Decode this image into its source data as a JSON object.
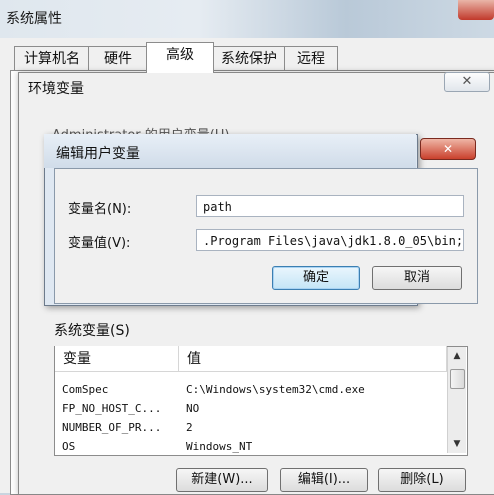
{
  "outer_window": {
    "title": "系统属性"
  },
  "tabs": [
    {
      "label": "计算机名"
    },
    {
      "label": "硬件"
    },
    {
      "label": "高级",
      "active": true
    },
    {
      "label": "系统保护"
    },
    {
      "label": "远程"
    }
  ],
  "env_dialog": {
    "title": "环境变量",
    "close_glyph": "✕",
    "user_vars_label": "Administrator 的用户变量(U)"
  },
  "edit_dialog": {
    "title": "编辑用户变量",
    "close_glyph": "✕",
    "name_label": "变量名(N):",
    "name_value": "path",
    "value_label": "变量值(V):",
    "value_value": ".Program Files\\java\\jdk1.8.0_05\\bin;",
    "ok_label": "确定",
    "cancel_label": "取消"
  },
  "system_vars": {
    "section_label": "系统变量(S)",
    "columns": [
      "变量",
      "值"
    ],
    "rows": [
      {
        "name": "ComSpec",
        "value": "C:\\Windows\\system32\\cmd.exe"
      },
      {
        "name": "FP_NO_HOST_C...",
        "value": "NO"
      },
      {
        "name": "NUMBER_OF_PR...",
        "value": "2"
      },
      {
        "name": "OS",
        "value": "Windows_NT"
      }
    ],
    "new_label": "新建(W)...",
    "edit_label": "编辑(I)...",
    "delete_label": "删除(L)"
  }
}
